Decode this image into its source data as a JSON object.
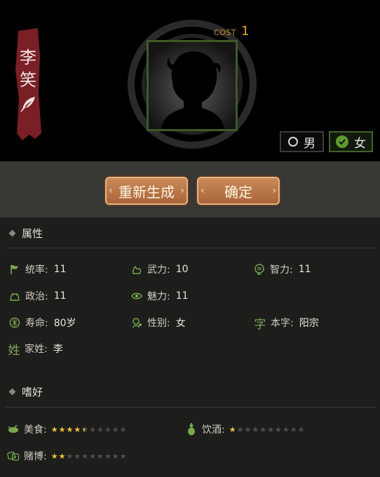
{
  "character": {
    "name_line1": "李",
    "name_line2": "笑"
  },
  "cost": {
    "label": "COST",
    "value": "1"
  },
  "gender_options": {
    "male": "男",
    "female": "女",
    "selected": "female"
  },
  "actions": {
    "regenerate": "重新生成",
    "confirm": "确定"
  },
  "sections": {
    "attributes": "属性",
    "hobbies": "嗜好"
  },
  "attributes": {
    "command": {
      "label": "统率:",
      "value": "11"
    },
    "force": {
      "label": "武力:",
      "value": "10"
    },
    "intellect": {
      "label": "智力:",
      "value": "11"
    },
    "politics": {
      "label": "政治:",
      "value": "11"
    },
    "charm": {
      "label": "魅力:",
      "value": "11"
    },
    "lifespan": {
      "label": "寿命:",
      "value": "80岁"
    },
    "gender": {
      "label": "性别:",
      "value": "女"
    },
    "courtesy": {
      "icon_text": "字",
      "label": "本字:",
      "value": "阳宗"
    },
    "surname": {
      "icon_text": "姓",
      "label": "家姓:",
      "value": "李"
    }
  },
  "hobbies": {
    "food": {
      "label": "美食:",
      "rating": 4.5,
      "max": 10
    },
    "wine": {
      "label": "饮酒:",
      "rating": 1,
      "max": 10
    },
    "gambling": {
      "label": "赌博:",
      "rating": 2,
      "max": 10
    }
  },
  "colors": {
    "accent_green": "#78a84e",
    "button_brown": "#b87447",
    "star_gold": "#f0c23a",
    "banner_red": "#7a1f26"
  }
}
